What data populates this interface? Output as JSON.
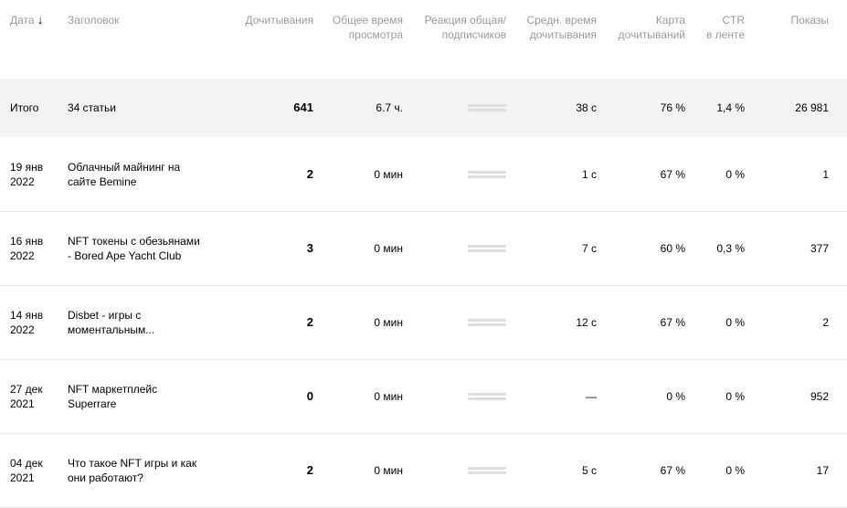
{
  "headers": {
    "date": "Дата",
    "date_sort_icon": "↓",
    "title": "Заголовок",
    "reads": "Дочитывания",
    "total_time_1": "Общее время",
    "total_time_2": "просмотра",
    "reaction_1": "Реакция общая/",
    "reaction_2": "подписчиков",
    "avg_time_1": "Средн. время",
    "avg_time_2": "дочитывания",
    "map_1": "Карта",
    "map_2": "дочитываний",
    "ctr_1": "CTR",
    "ctr_2": "в ленте",
    "views": "Показы"
  },
  "total": {
    "label": "Итого",
    "title": "34 статьи",
    "reads": "641",
    "total_time": "6.7 ч.",
    "avg_time": "38 с",
    "map": "76 %",
    "ctr": "1,4 %",
    "views": "26 981"
  },
  "rows": [
    {
      "date_1": "19 янв",
      "date_2": "2022",
      "title_1": "Облачный майнинг на",
      "title_2": "сайте Bemine",
      "reads": "2",
      "total_time": "0 мин",
      "avg_time": "1 с",
      "map": "67 %",
      "ctr": "0 %",
      "views": "1"
    },
    {
      "date_1": "16 янв",
      "date_2": "2022",
      "title_1": "NFT токены с обезьянами",
      "title_2": "- Bored Ape Yacht Club",
      "reads": "3",
      "total_time": "0 мин",
      "avg_time": "7 с",
      "map": "60 %",
      "ctr": "0,3 %",
      "views": "377"
    },
    {
      "date_1": "14 янв",
      "date_2": "2022",
      "title_1": "Disbet - игры с",
      "title_2": "моментальным...",
      "reads": "2",
      "total_time": "0 мин",
      "avg_time": "12 с",
      "map": "67 %",
      "ctr": "0 %",
      "views": "2"
    },
    {
      "date_1": "27 дек",
      "date_2": "2021",
      "title_1": "NFT маркетплейс",
      "title_2": "Superrare",
      "reads": "0",
      "total_time": "0 мин",
      "avg_time": "—",
      "map": "0 %",
      "ctr": "0 %",
      "views": "952"
    },
    {
      "date_1": "04 дек",
      "date_2": "2021",
      "title_1": "Что такое NFT игры и как",
      "title_2": "они работают?",
      "reads": "2",
      "total_time": "0 мин",
      "avg_time": "5 с",
      "map": "67 %",
      "ctr": "0 %",
      "views": "17"
    }
  ]
}
